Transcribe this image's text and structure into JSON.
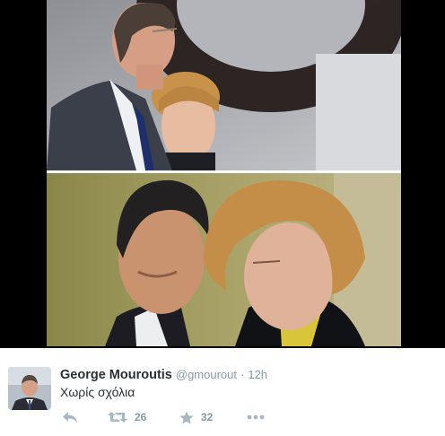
{
  "tweet": {
    "display_name": "George Mouroutis",
    "handle": "@gmourout",
    "separator": "·",
    "time": "12h",
    "text": "Χωρίς σχόλια",
    "retweet_count": "26",
    "favorite_count": "32"
  },
  "icons": {
    "reply": "reply-icon",
    "retweet": "retweet-icon",
    "favorite": "star-icon",
    "more": "more-dots-icon"
  },
  "colors": {
    "name": "#292f33",
    "meta": "#8899a6",
    "icon": "#aab8c2",
    "media_background": "#000000"
  }
}
